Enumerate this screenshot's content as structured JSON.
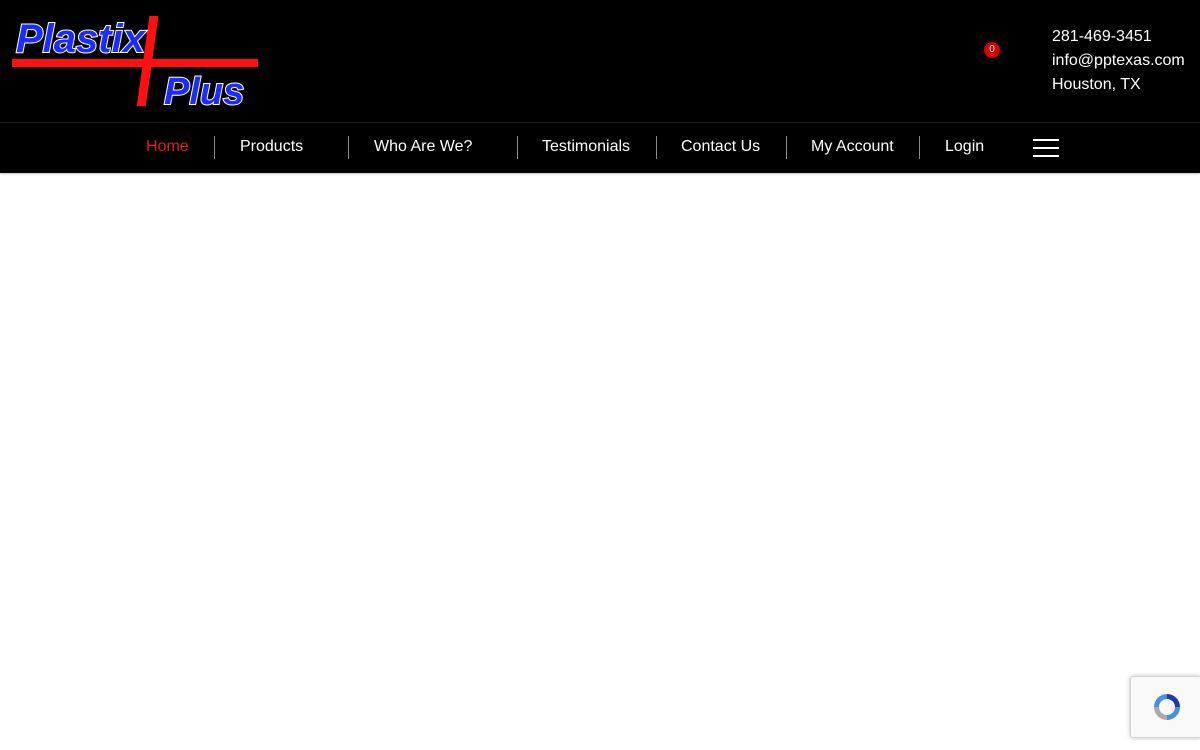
{
  "brand": {
    "logo_line1": "Plastix",
    "logo_line2": "Plus",
    "logo_text_color": "#1a2cff",
    "logo_cross_color": "#ff1010"
  },
  "cart": {
    "count": "0",
    "icon": "shopping-cart-icon"
  },
  "contact": {
    "phone": "281-469-3451",
    "email": "info@pptexas.com",
    "location": "Houston, TX"
  },
  "nav": {
    "items": [
      {
        "label": "Home"
      },
      {
        "label": "Products"
      },
      {
        "label": "Who Are We?"
      },
      {
        "label": "Testimonials"
      },
      {
        "label": "Contact Us"
      },
      {
        "label": "My Account"
      },
      {
        "label": "Login"
      }
    ],
    "menu_icon": "hamburger-menu-icon",
    "active_color": "#e31b23"
  },
  "recaptcha": {
    "icon": "recaptcha-icon"
  }
}
